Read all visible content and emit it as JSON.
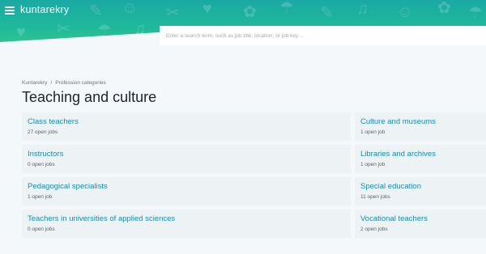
{
  "header": {
    "logo_text": "kuntarekry",
    "gradient_colors": [
      "#1aa9a4",
      "#37c98e"
    ]
  },
  "search": {
    "placeholder": "Enter a search term, such as job title, location, or job key ..."
  },
  "breadcrumb": {
    "home": "Kuntarekry",
    "separator": "/",
    "current": "Profession categories"
  },
  "page": {
    "title": "Teaching and culture"
  },
  "categories": [
    {
      "label": "Class teachers",
      "count": "27 open jobs"
    },
    {
      "label": "Culture and museums",
      "count": "1 open job"
    },
    {
      "label": "Instructors",
      "count": "0 open jobs"
    },
    {
      "label": "Libraries and archives",
      "count": "1 open job"
    },
    {
      "label": "Pedagogical specialists",
      "count": "1 open job"
    },
    {
      "label": "Special education",
      "count": "11 open jobs"
    },
    {
      "label": "Teachers in universities of applied sciences",
      "count": "0 open jobs"
    },
    {
      "label": "Vocational teachers",
      "count": "2 open jobs"
    }
  ],
  "colors": {
    "link": "#168eaa",
    "card_bg": "#edf2f5",
    "page_bg": "#f5f8fa"
  }
}
